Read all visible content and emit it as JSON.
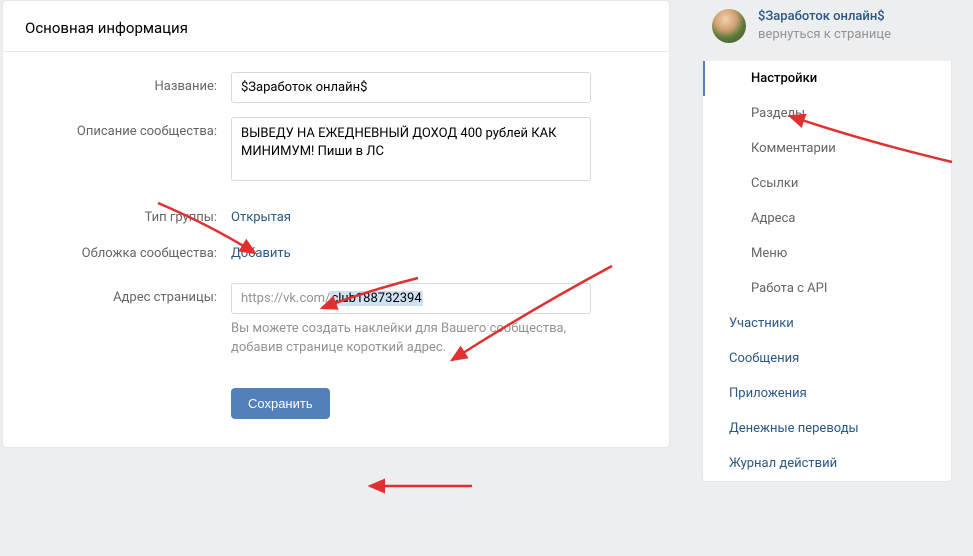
{
  "header": {
    "title": "Основная информация"
  },
  "form": {
    "name_label": "Название:",
    "name_value": "$Заработок онлайн$",
    "desc_label": "Описание сообщества:",
    "desc_value": "ВЫВЕДУ НА ЕЖЕДНЕВНЫЙ ДОХОД 400 рублей КАК МИНИМУМ! Пиши в ЛС",
    "group_type_label": "Тип группы:",
    "group_type_value": "Открытая",
    "cover_label": "Обложка сообщества:",
    "cover_value": "Добавить",
    "address_label": "Адрес страницы:",
    "address_prefix": "https://vk.com/",
    "address_value": "club188732394",
    "address_hint": "Вы можете создать наклейки для Вашего сообщества, добавив странице короткий адрес.",
    "save_label": "Сохранить"
  },
  "profile": {
    "name": "$Заработок онлайн$",
    "back": "вернуться к странице"
  },
  "nav": {
    "items": [
      {
        "label": "Настройки",
        "sub": true,
        "active": true
      },
      {
        "label": "Разделы",
        "sub": true
      },
      {
        "label": "Комментарии",
        "sub": true
      },
      {
        "label": "Ссылки",
        "sub": true
      },
      {
        "label": "Адреса",
        "sub": true
      },
      {
        "label": "Меню",
        "sub": true
      },
      {
        "label": "Работа с API",
        "sub": true
      },
      {
        "label": "Участники"
      },
      {
        "label": "Сообщения"
      },
      {
        "label": "Приложения"
      },
      {
        "label": "Денежные переводы"
      },
      {
        "label": "Журнал действий"
      }
    ]
  }
}
